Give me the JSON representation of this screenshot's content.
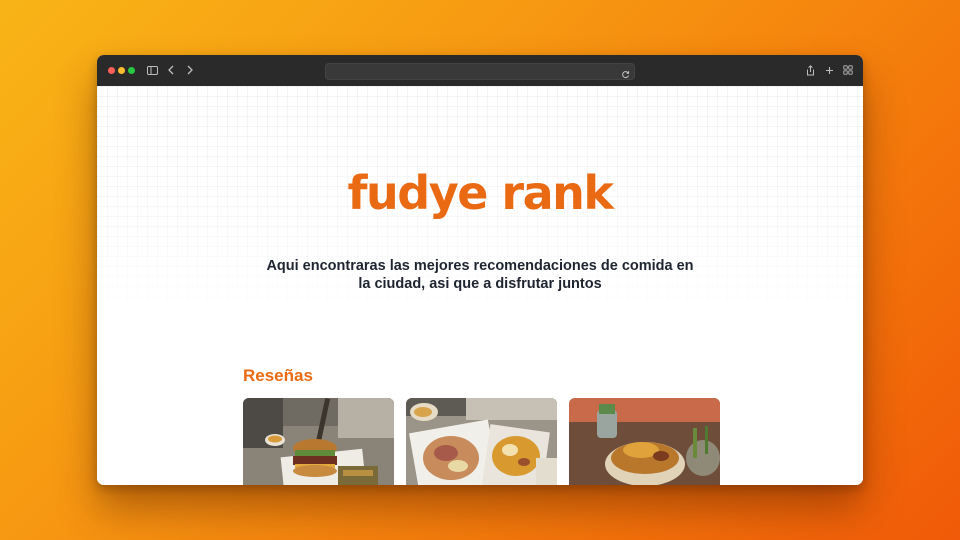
{
  "browser": {
    "url": "",
    "icons": [
      "sidebar-icon",
      "back-icon",
      "forward-icon",
      "reload-icon",
      "share-icon",
      "new-tab-icon",
      "tab-overview-icon"
    ]
  },
  "hero": {
    "title": "fudye rank",
    "subtitle": "Aqui encontraras las mejores recomendaciones de comida en la ciudad, asi que a disfrutar juntos"
  },
  "reviews": {
    "title": "Reseñas",
    "cards": [
      {
        "image": "burger-photo"
      },
      {
        "image": "loaded-fries-photo"
      },
      {
        "image": "noodle-bowl-photo"
      }
    ]
  },
  "colors": {
    "accent": "#ea6a14",
    "text": "#1f2530",
    "toolbar": "#2b2a2b",
    "background_gradient": [
      "#f8b416",
      "#f05a08"
    ]
  }
}
